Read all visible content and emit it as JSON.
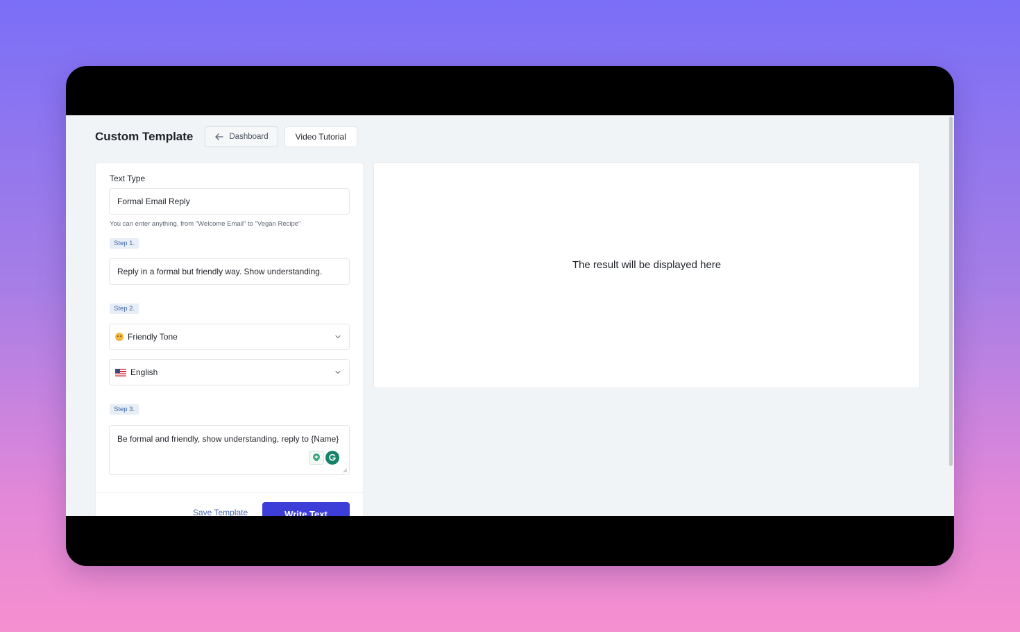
{
  "header": {
    "title": "Custom Template",
    "dashboard_label": "Dashboard",
    "video_tutorial_label": "Video Tutorial"
  },
  "form": {
    "text_type": {
      "label": "Text Type",
      "value": "Formal Email Reply",
      "hint": "You can enter anything, from \"Welcome Email\" to \"Vegan Recipe\""
    },
    "step1": {
      "badge": "Step 1.",
      "value": "Reply in a formal but friendly way. Show understanding."
    },
    "step2": {
      "badge": "Step 2.",
      "tone": {
        "value": "Friendly Tone",
        "icon": "smiling-face-icon"
      },
      "language": {
        "value": "English",
        "icon": "us-flag-icon"
      }
    },
    "step3": {
      "badge": "Step 3.",
      "value": "Be formal and friendly, show understanding, reply to {Name}"
    },
    "save_label": "Save Template",
    "write_label": "Write Text"
  },
  "result": {
    "placeholder": "The result will be displayed here"
  },
  "colors": {
    "accent": "#3d3ed8",
    "badge_bg": "#e8eef6",
    "badge_text": "#3a64a8"
  }
}
